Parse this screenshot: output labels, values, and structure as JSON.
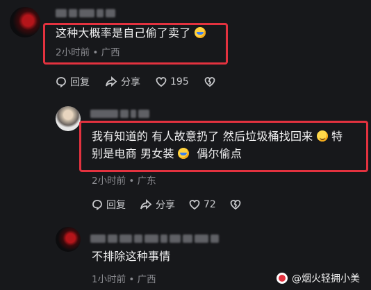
{
  "comments": [
    {
      "text": "这种大概率是自己偷了卖了",
      "emoji": "laugh-cry-emoji",
      "time": "2小时前",
      "location": "广西",
      "actions": {
        "reply": "回复",
        "share": "分享",
        "likes": "195"
      }
    },
    {
      "text_line1_a": "我有知道的 有人故意扔了 然后垃圾桶找回来",
      "text_line1_b": "特",
      "text_line2_a": "别是电商 男女装",
      "text_line2_b": "偶尔偷点",
      "time": "2小时前",
      "location": "广东",
      "actions": {
        "reply": "回复",
        "share": "分享",
        "likes": "72"
      }
    },
    {
      "text": "不排除这种事情",
      "time": "1小时前",
      "location": "广西"
    }
  ],
  "separator": "•",
  "watermark": {
    "text": "@烟火轻拥小美"
  },
  "colors": {
    "highlight": "#e3323f",
    "background": "#17181b"
  }
}
